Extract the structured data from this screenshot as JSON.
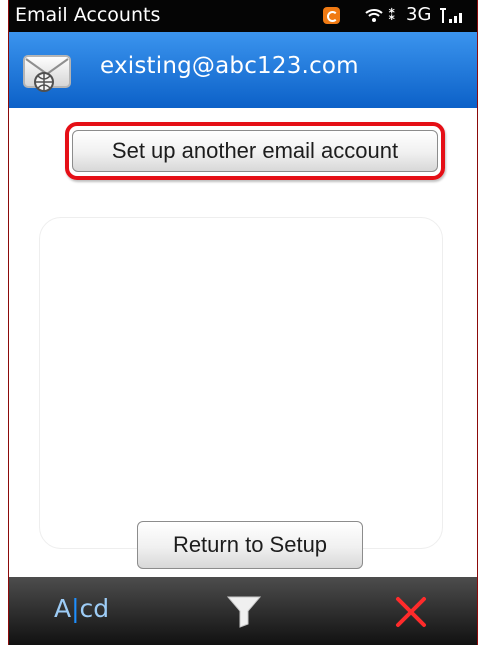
{
  "status_bar": {
    "title": "Email Accounts",
    "network": "3G"
  },
  "account": {
    "email": "existing@abc123.com"
  },
  "actions": {
    "setup_label": "Set up another email account",
    "return_label": "Return to Setup"
  },
  "toolbar": {
    "format_prefix": "A",
    "format_suffix": "cd",
    "icons": [
      "format-icon",
      "filter-icon",
      "close-icon"
    ]
  },
  "colors": {
    "header_blue": "#0c61c8",
    "highlight_red": "#e50f16",
    "close_red": "#ff2b2b",
    "bottom_bar": "#111111"
  }
}
